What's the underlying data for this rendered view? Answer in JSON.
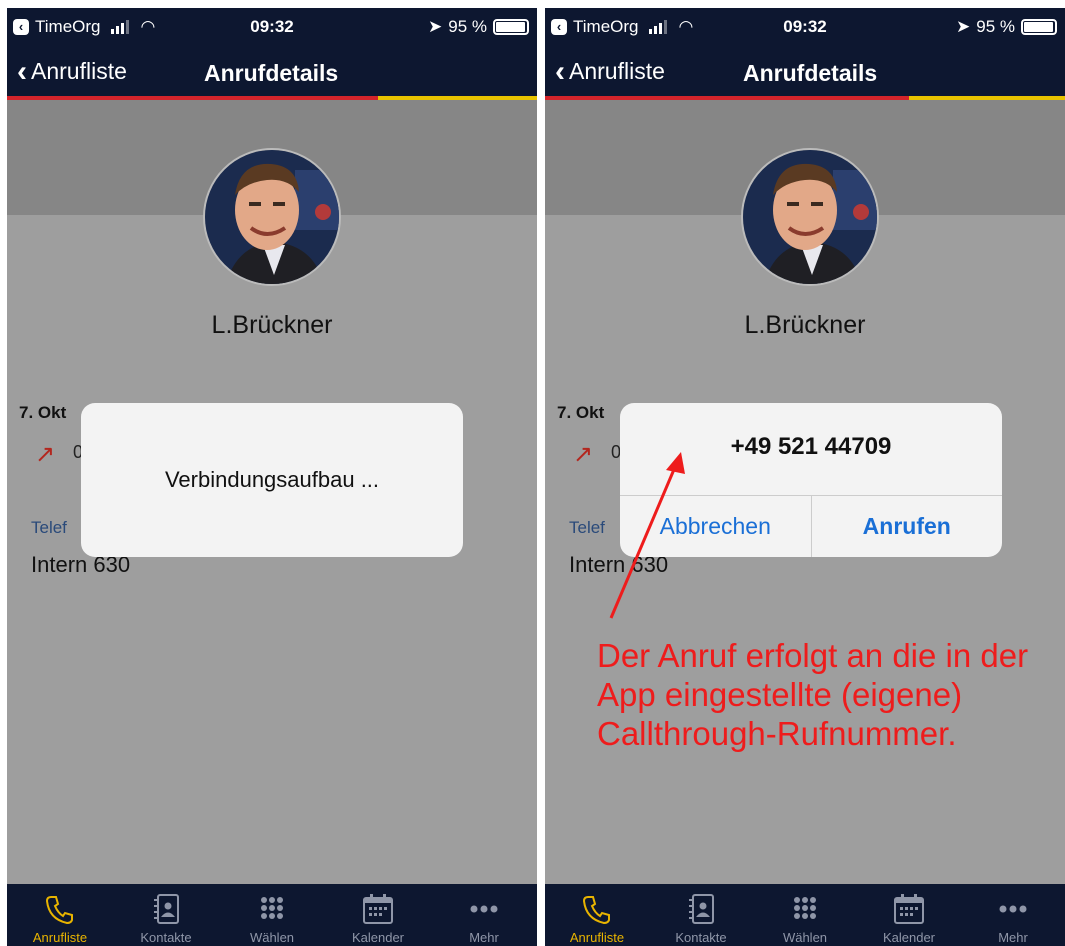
{
  "left": {
    "status": {
      "carrier": "TimeOrg",
      "time": "09:32",
      "battery": "95 %",
      "battery_level": 0.95
    },
    "nav": {
      "back": "Anrufliste",
      "title": "Anrufdetails"
    },
    "contact": {
      "name": "L.Brückner"
    },
    "details": {
      "date": "7. Okt",
      "call_arrow": "↗",
      "call_trunc": "0",
      "phone_label": "Telef",
      "phone_value": "Intern 630"
    },
    "dialog": {
      "text": "Verbindungsaufbau ..."
    },
    "tabs": [
      {
        "label": "Anrufliste",
        "icon": "phone-icon"
      },
      {
        "label": "Kontakte",
        "icon": "contacts-icon"
      },
      {
        "label": "Wählen",
        "icon": "keypad-icon"
      },
      {
        "label": "Kalender",
        "icon": "calendar-icon"
      },
      {
        "label": "Mehr",
        "icon": "more-icon"
      }
    ]
  },
  "right": {
    "status": {
      "carrier": "TimeOrg",
      "time": "09:32",
      "battery": "95 %",
      "battery_level": 0.95
    },
    "nav": {
      "back": "Anrufliste",
      "title": "Anrufdetails"
    },
    "contact": {
      "name": "L.Brückner"
    },
    "details": {
      "date": "7. Okt",
      "call_arrow": "↗",
      "call_trunc": "0",
      "phone_label": "Telef",
      "phone_value": "Intern 630"
    },
    "dialog": {
      "number": "+49 521 44709",
      "cancel": "Abbrechen",
      "call": "Anrufen"
    },
    "annotation": "Der Anruf erfolgt an die in der App eingestellte (eigene) Callthrough-Rufnummer.",
    "tabs": [
      {
        "label": "Anrufliste",
        "icon": "phone-icon"
      },
      {
        "label": "Kontakte",
        "icon": "contacts-icon"
      },
      {
        "label": "Wählen",
        "icon": "keypad-icon"
      },
      {
        "label": "Kalender",
        "icon": "calendar-icon"
      },
      {
        "label": "Mehr",
        "icon": "more-icon"
      }
    ]
  },
  "colors": {
    "nav_bg": "#0d1730",
    "accent_red": "#d3242b",
    "accent_yellow": "#e8c300",
    "tab_active": "#e8b400",
    "annotation": "#ee1c1c",
    "link_blue": "#1a6fd6"
  }
}
